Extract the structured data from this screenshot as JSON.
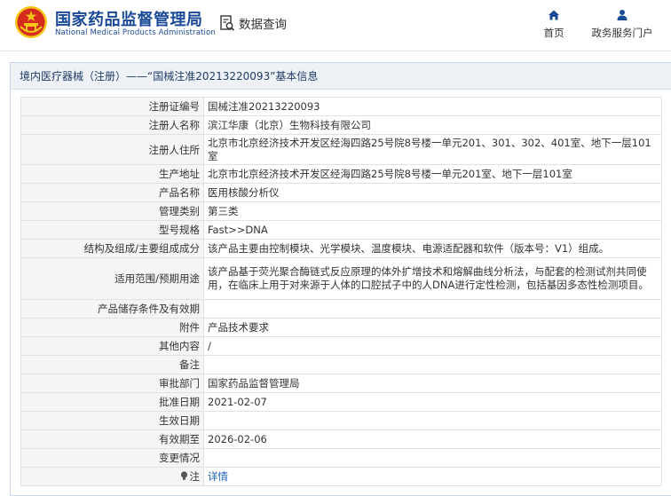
{
  "header": {
    "title_cn": "国家药品监督管理局",
    "title_en": "National Medical Products Administration",
    "data_query": "数据查询",
    "nav": [
      {
        "label": "首页",
        "icon": "home-icon"
      },
      {
        "label": "政务服务门户",
        "icon": "user-icon"
      }
    ]
  },
  "panel": {
    "title": "境内医疗器械（注册）——“国械注准20213220093”基本信息"
  },
  "rows": [
    {
      "label": "注册证编号",
      "value": "国械注准20213220093"
    },
    {
      "label": "注册人名称",
      "value": "滨江华康（北京）生物科技有限公司"
    },
    {
      "label": "注册人住所",
      "value": "北京市北京经济技术开发区经海四路25号院8号楼一单元201、301、302、401室、地下一层101室"
    },
    {
      "label": "生产地址",
      "value": "北京市北京经济技术开发区经海四路25号院8号楼一单元201室、地下一层101室"
    },
    {
      "label": "产品名称",
      "value": "医用核酸分析仪"
    },
    {
      "label": "管理类别",
      "value": "第三类"
    },
    {
      "label": "型号规格",
      "value": "Fast>>DNA"
    },
    {
      "label": "结构及组成/主要组成成分",
      "value": "该产品主要由控制模块、光学模块、温度模块、电源适配器和软件（版本号：V1）组成。"
    },
    {
      "label": "适用范围/预期用途",
      "value": "该产品基于荧光聚合酶链式反应原理的体外扩增技术和熔解曲线分析法，与配套的检测试剂共同使用，在临床上用于对来源于人体的口腔拭子中的人DNA进行定性检测，包括基因多态性检测项目。"
    },
    {
      "label": "产品储存条件及有效期",
      "value": ""
    },
    {
      "label": "附件",
      "value": "产品技术要求"
    },
    {
      "label": "其他内容",
      "value": "/"
    },
    {
      "label": "备注",
      "value": ""
    },
    {
      "label": "审批部门",
      "value": "国家药品监督管理局"
    },
    {
      "label": "批准日期",
      "value": "2021-02-07"
    },
    {
      "label": "生效日期",
      "value": ""
    },
    {
      "label": "有效期至",
      "value": "2026-02-06"
    },
    {
      "label": "变更情况",
      "value": ""
    },
    {
      "label": "注",
      "value": "详情"
    }
  ],
  "colors": {
    "brand": "#1a4a96",
    "link": "#1a5fb4",
    "label_bg": "#f5f5f5",
    "panel_title_bg": "#eef2f7",
    "emblem_red": "#d52b1e",
    "emblem_gold": "#f5c518"
  }
}
